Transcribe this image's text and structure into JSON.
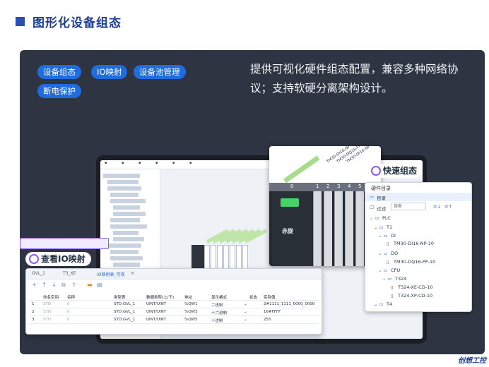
{
  "header": {
    "title": "图形化设备组态"
  },
  "tags": [
    "设备组态",
    "IO映射",
    "设备池管理",
    "断电保护"
  ],
  "description": "提供可视化硬件组态配置，兼容多种网络协议；支持软硬分离架构设计。",
  "callouts": {
    "quick_config": "快速组态",
    "io_map": "查看IO映射"
  },
  "zoom": {
    "slots": [
      "0",
      "1",
      "2",
      "3",
      "4",
      "5",
      "6"
    ],
    "cpu_brand": "赤旋",
    "module_labels": [
      "TM30-DI16-NP-10",
      "TM30-DQ16-PP-10",
      "TM30-DI16-NP-10"
    ]
  },
  "catalog": {
    "title": "硬件目录",
    "tab": "目录",
    "filter_label": "过滤",
    "search_placeholder": "搜索",
    "tree": [
      {
        "label": "PLC",
        "level": 0
      },
      {
        "label": "T1",
        "level": 1
      },
      {
        "label": "DI",
        "level": 2
      },
      {
        "label": "TM30-DI16-NP-10",
        "level": 3,
        "selected": true
      },
      {
        "label": "DO",
        "level": 2
      },
      {
        "label": "TM30-DQ16-PP-10",
        "level": 3
      },
      {
        "label": "CPU",
        "level": 2
      },
      {
        "label": "T324",
        "level": 3
      },
      {
        "label": "T324-XE-CD-10",
        "level": 4
      },
      {
        "label": "T324-XP-CD-10",
        "level": 4
      },
      {
        "label": "T4",
        "level": 1
      }
    ]
  },
  "io_window": {
    "tabs": [
      "GVL_1",
      "T3_XE",
      "IO映射表_可视"
    ],
    "columns": [
      "命名空间",
      "名称",
      "类型表",
      "数据类型(上/下)",
      "地址",
      "显示格式",
      "状态",
      "实际值"
    ],
    "rows": [
      [
        "STD",
        "0",
        "STD:GVL_1",
        "UINT/UINT",
        "%QW1",
        "二进制",
        "",
        "2#1111_1111_0000_0000"
      ],
      [
        "STD",
        "0",
        "STD:GVL_1",
        "UINT/UINT",
        "%QW3",
        "十六进制",
        "",
        "16#FFFF"
      ],
      [
        "STD",
        "0",
        "STD:GVL_1",
        "UINT/UINT",
        "%QW5",
        "十进制",
        "",
        "255"
      ]
    ]
  },
  "watermark": "创想工控",
  "colors": {
    "accent": "#1f6be0",
    "panel": "#2e3441",
    "highlight": "#8a5cf0",
    "title": "#1e3f93"
  }
}
